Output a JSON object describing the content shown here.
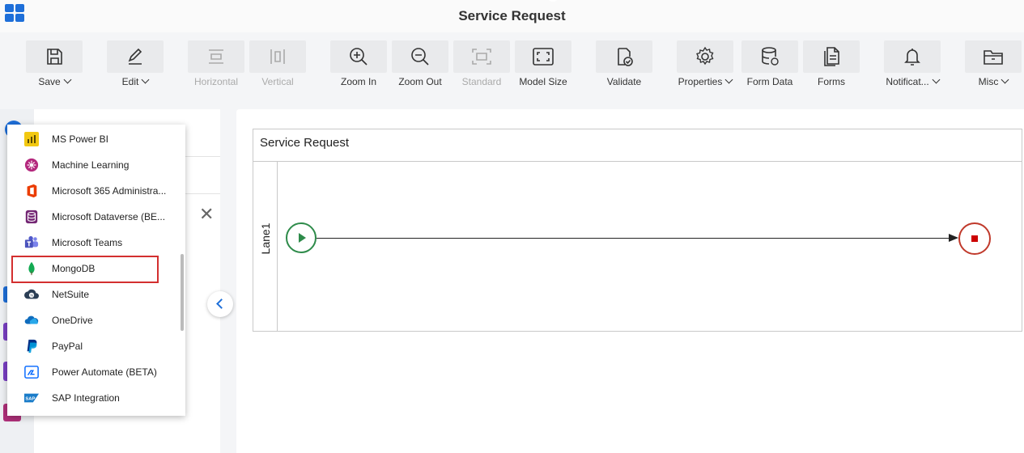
{
  "header": {
    "title": "Service Request"
  },
  "toolbar": {
    "items": [
      {
        "label": "Save",
        "icon": "save-icon",
        "caret": true,
        "disabled": false
      },
      {
        "label": "Edit",
        "icon": "edit-icon",
        "caret": true,
        "disabled": false
      },
      {
        "label": "Horizontal",
        "icon": "horizontal-icon",
        "caret": false,
        "disabled": true
      },
      {
        "label": "Vertical",
        "icon": "vertical-icon",
        "caret": false,
        "disabled": true
      },
      {
        "label": "Zoom In",
        "icon": "zoom-in-icon",
        "caret": false,
        "disabled": false
      },
      {
        "label": "Zoom Out",
        "icon": "zoom-out-icon",
        "caret": false,
        "disabled": false
      },
      {
        "label": "Standard",
        "icon": "standard-icon",
        "caret": false,
        "disabled": true
      },
      {
        "label": "Model Size",
        "icon": "model-size-icon",
        "caret": false,
        "disabled": false
      },
      {
        "label": "Validate",
        "icon": "validate-icon",
        "caret": false,
        "disabled": false
      },
      {
        "label": "Properties",
        "icon": "gear-icon",
        "caret": true,
        "disabled": false
      },
      {
        "label": "Form Data",
        "icon": "database-icon",
        "caret": false,
        "disabled": false
      },
      {
        "label": "Forms",
        "icon": "forms-icon",
        "caret": false,
        "disabled": false
      },
      {
        "label": "Notificat...",
        "icon": "bell-icon",
        "caret": true,
        "disabled": false
      },
      {
        "label": "Misc",
        "icon": "folder-icon",
        "caret": true,
        "disabled": false
      }
    ]
  },
  "canvas": {
    "pool_title": "Service Request",
    "lane_label": "Lane1"
  },
  "dropdown": {
    "items": [
      {
        "label": "MS Power BI",
        "icon": "power-bi-icon"
      },
      {
        "label": "Machine Learning",
        "icon": "machine-learning-icon"
      },
      {
        "label": "Microsoft 365 Administra...",
        "icon": "office365-icon"
      },
      {
        "label": "Microsoft Dataverse (BE...",
        "icon": "dataverse-icon"
      },
      {
        "label": "Microsoft Teams",
        "icon": "teams-icon"
      },
      {
        "label": "MongoDB",
        "icon": "mongodb-icon",
        "selected": true
      },
      {
        "label": "NetSuite",
        "icon": "netsuite-icon"
      },
      {
        "label": "OneDrive",
        "icon": "onedrive-icon"
      },
      {
        "label": "PayPal",
        "icon": "paypal-icon"
      },
      {
        "label": "Power Automate (BETA)",
        "icon": "power-automate-icon"
      },
      {
        "label": "SAP Integration",
        "icon": "sap-icon"
      }
    ]
  },
  "colors": {
    "accent": "#1e6fd9",
    "start_event": "#2e8b4a",
    "end_event": "#c0392b",
    "selection": "#d32f2f"
  }
}
